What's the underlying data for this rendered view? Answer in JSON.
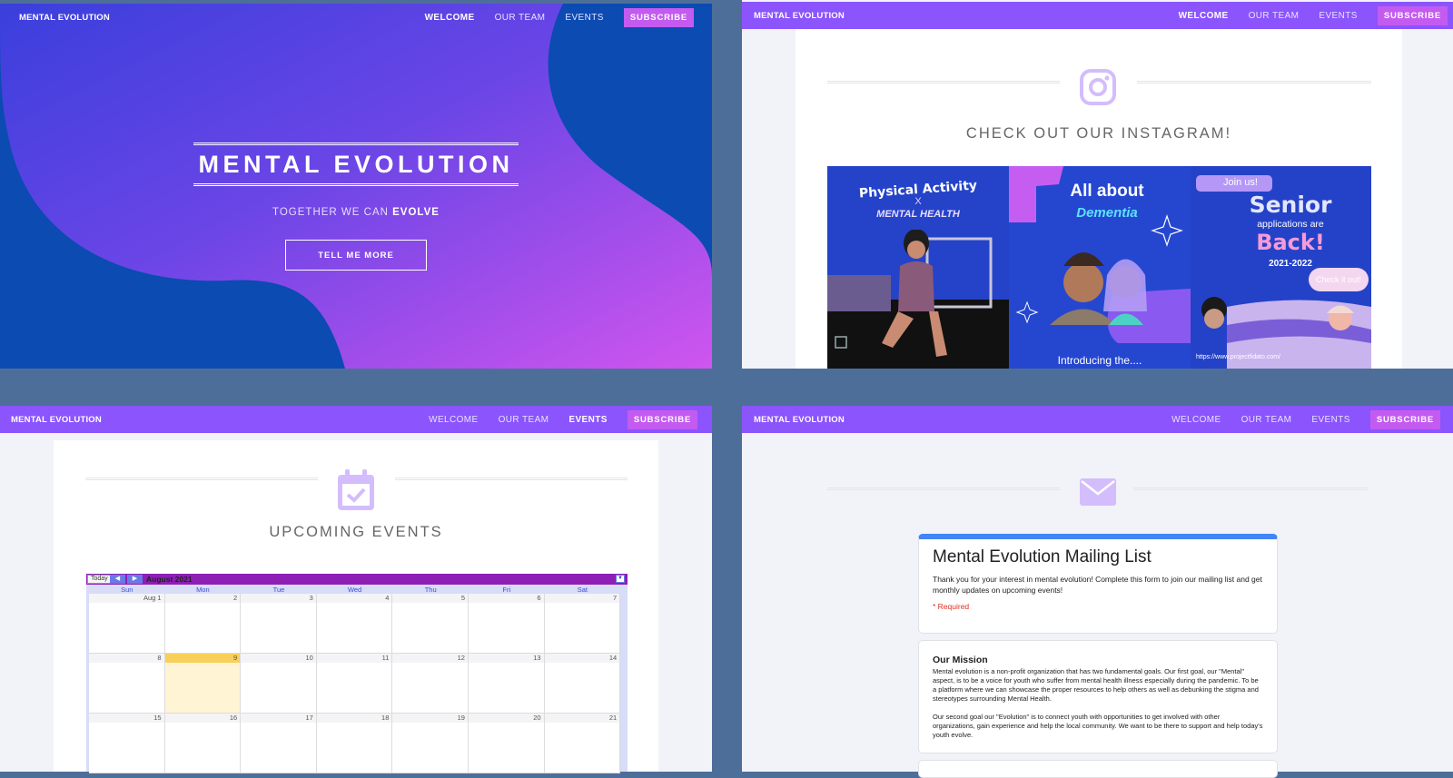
{
  "nav": {
    "brand": "MENTAL EVOLUTION",
    "links": [
      "WELCOME",
      "OUR TEAM",
      "EVENTS"
    ],
    "subscribe": "SUBSCRIBE"
  },
  "hero": {
    "title": "MENTAL EVOLUTION",
    "subtitle_prefix": "TOGETHER WE CAN",
    "subtitle_bold": "EVOLVE",
    "button": "TELL ME MORE"
  },
  "instagram": {
    "title": "CHECK OUT OUR INSTAGRAM!",
    "icon": "instagram-icon",
    "posts": [
      {
        "line1": "Physical Activity",
        "line2": "X",
        "line3": "MENTAL HEALTH"
      },
      {
        "line1": "All about",
        "line2": "Dementia",
        "line3": "Introducing the...."
      },
      {
        "line1": "Join us!",
        "line2": "Senior",
        "line3": "applications are",
        "line4": "Back!",
        "line5": "2021-2022",
        "line6": "Check it out!",
        "line7": "https://www.projectfidato.com/"
      }
    ]
  },
  "events": {
    "title": "UPCOMING EVENTS",
    "icon": "calendar-check-icon",
    "calendar": {
      "today_label": "Today",
      "month": "August 2021",
      "weekdays": [
        "Sun",
        "Mon",
        "Tue",
        "Wed",
        "Thu",
        "Fri",
        "Sat"
      ],
      "weeks": [
        [
          "Aug 1",
          "2",
          "3",
          "4",
          "5",
          "6",
          "7"
        ],
        [
          "8",
          "9",
          "10",
          "11",
          "12",
          "13",
          "14"
        ],
        [
          "15",
          "16",
          "17",
          "18",
          "19",
          "20",
          "21"
        ]
      ],
      "highlight_day": "9"
    }
  },
  "mailing": {
    "icon": "envelope-icon",
    "form_title": "Mental Evolution Mailing List",
    "form_desc": "Thank you for your interest in mental evolution! Complete this form to join our mailing list and get monthly updates on upcoming events!",
    "required": "* Required",
    "mission_heading": "Our Mission",
    "mission_p1": "Mental evolution is a non-profit organization that has two fundamental goals.  Our first goal, our \"Mental\" aspect, is to be a voice for youth who suffer from mental health illness especially during the pandemic. To be a platform where we can showcase the proper resources to help others as well as debunking the stigma and stereotypes surrounding Mental Health.",
    "mission_p2": "Our second goal our \"Evolution\" is to connect youth with opportunities to get involved with other organizations, gain experience and help the local community.  We want to be there to support and help today's youth evolve."
  },
  "colors": {
    "nav_purple": "#8b54fd",
    "subscribe_pink": "#c45bf0",
    "hero_blue": "#0b4bb2",
    "calendar_bar": "#8d1fb5",
    "form_accent": "#4285f4"
  }
}
